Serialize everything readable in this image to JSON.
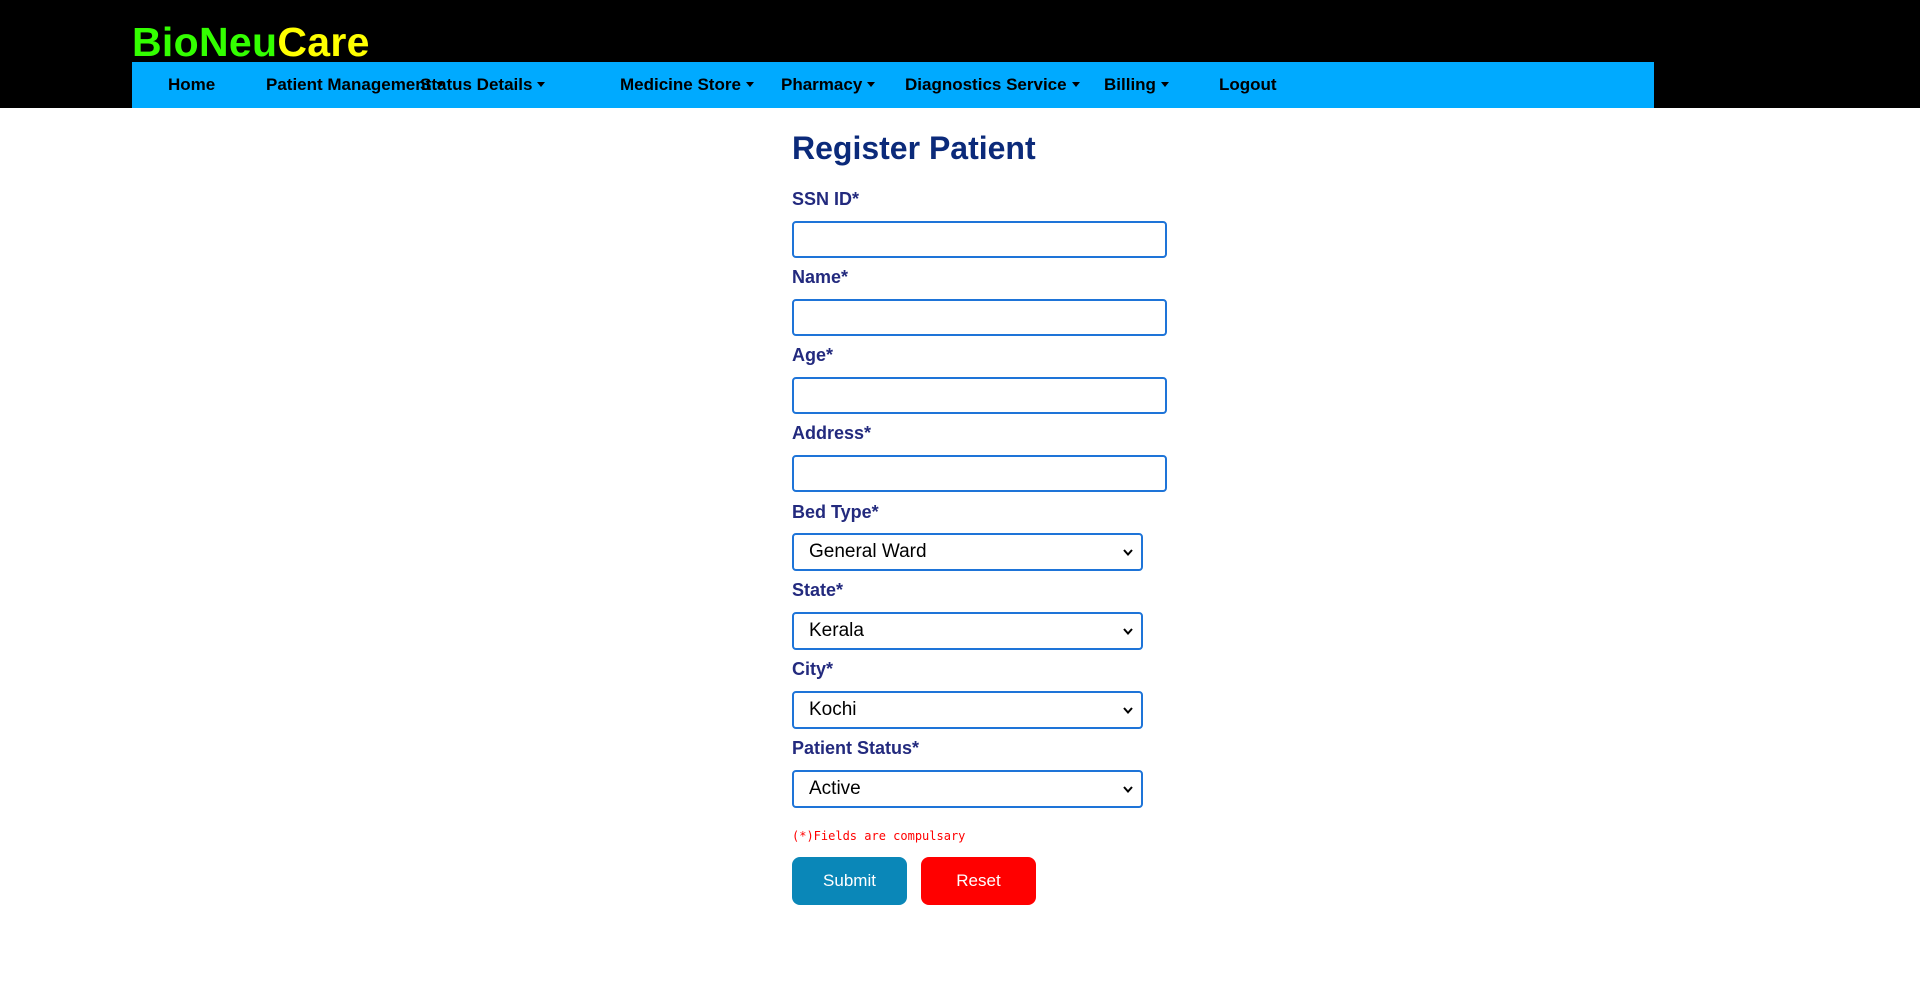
{
  "brand": {
    "part1": "BioNeu",
    "part2": "Care",
    "color1": "#33ff00",
    "color2": "#ffff00"
  },
  "nav": {
    "background": "#00aaff",
    "items": [
      {
        "label": "Home",
        "dropdown": false
      },
      {
        "label": "Patient Management",
        "dropdown": true
      },
      {
        "label": "Status Details",
        "dropdown": true
      },
      {
        "label": "Medicine Store",
        "dropdown": true
      },
      {
        "label": "Pharmacy",
        "dropdown": true
      },
      {
        "label": "Diagnostics Service",
        "dropdown": true
      },
      {
        "label": "Billing",
        "dropdown": true
      },
      {
        "label": "Logout",
        "dropdown": false
      }
    ]
  },
  "form": {
    "title": "Register Patient",
    "fields": {
      "ssn": {
        "label": "SSN ID*",
        "value": ""
      },
      "name": {
        "label": "Name*",
        "value": ""
      },
      "age": {
        "label": "Age*",
        "value": ""
      },
      "address": {
        "label": "Address*",
        "value": ""
      },
      "bed_type": {
        "label": "Bed Type*",
        "selected": "General Ward"
      },
      "state": {
        "label": "State*",
        "selected": "Kerala"
      },
      "city": {
        "label": "City*",
        "selected": "Kochi"
      },
      "patient_status": {
        "label": "Patient Status*",
        "selected": "Active"
      }
    },
    "note": "(*)Fields are compulsary",
    "submit_label": "Submit",
    "reset_label": "Reset",
    "colors": {
      "title": "#0b2a7a",
      "label": "#232a7e",
      "input_border": "#1e74d8",
      "submit_bg": "#0a87b8",
      "reset_bg": "#ff0000",
      "note": "#ff0000"
    }
  }
}
